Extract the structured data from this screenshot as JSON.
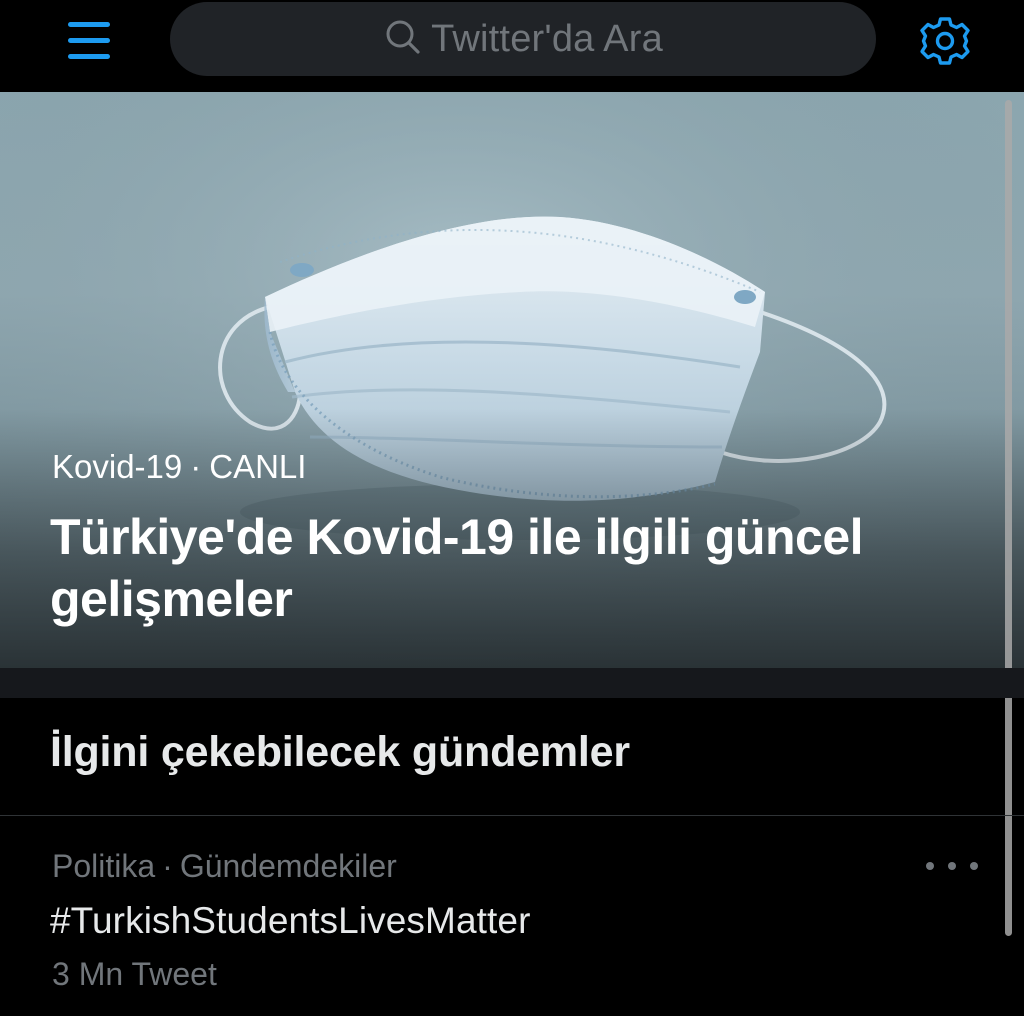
{
  "header": {
    "search_placeholder": "Twitter'da Ara"
  },
  "hero": {
    "category": "Kovid-19",
    "separator": "·",
    "status": "CANLI",
    "title": "Türkiye'de Kovid-19 ile ilgili güncel gelişmeler"
  },
  "trends": {
    "section_title": "İlgini çekebilecek gündemler",
    "items": [
      {
        "category": "Politika",
        "separator": "·",
        "context": "Gündemdekiler",
        "name": "#TurkishStudentsLivesMatter",
        "count": "3 Mn Tweet"
      }
    ]
  },
  "colors": {
    "accent": "#1d9bf0",
    "background": "#000000",
    "search_bg": "#202327",
    "muted_text": "#71767b",
    "primary_text": "#e7e9ea"
  },
  "icons": {
    "menu": "hamburger-icon",
    "search": "search-icon",
    "settings": "gear-icon",
    "more": "more-horizontal-icon"
  }
}
